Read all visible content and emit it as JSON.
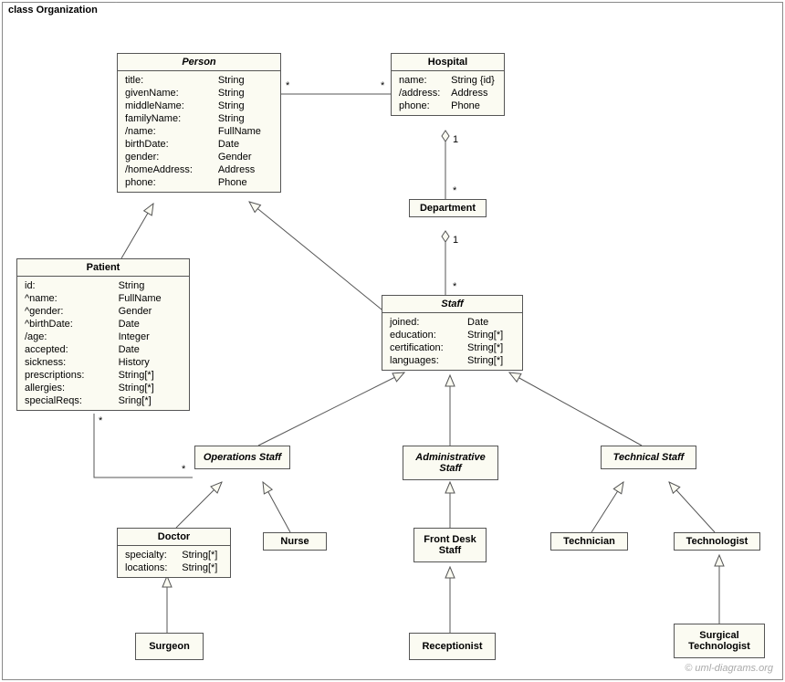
{
  "frame": {
    "title": "class Organization"
  },
  "classes": {
    "person": {
      "title": "Person",
      "attrs": [
        [
          "title:",
          "String"
        ],
        [
          "givenName:",
          "String"
        ],
        [
          "middleName:",
          "String"
        ],
        [
          "familyName:",
          "String"
        ],
        [
          "/name:",
          "FullName"
        ],
        [
          "birthDate:",
          "Date"
        ],
        [
          "gender:",
          "Gender"
        ],
        [
          "/homeAddress:",
          "Address"
        ],
        [
          "phone:",
          "Phone"
        ]
      ]
    },
    "hospital": {
      "title": "Hospital",
      "attrs": [
        [
          "name:",
          "String {id}"
        ],
        [
          "/address:",
          "Address"
        ],
        [
          "phone:",
          "Phone"
        ]
      ]
    },
    "department": {
      "title": "Department"
    },
    "patient": {
      "title": "Patient",
      "attrs": [
        [
          "id:",
          "String"
        ],
        [
          "^name:",
          "FullName"
        ],
        [
          "^gender:",
          "Gender"
        ],
        [
          "^birthDate:",
          "Date"
        ],
        [
          "/age:",
          "Integer"
        ],
        [
          "accepted:",
          "Date"
        ],
        [
          "sickness:",
          "History"
        ],
        [
          "prescriptions:",
          "String[*]"
        ],
        [
          "allergies:",
          "String[*]"
        ],
        [
          "specialReqs:",
          "Sring[*]"
        ]
      ]
    },
    "staff": {
      "title": "Staff",
      "attrs": [
        [
          "joined:",
          "Date"
        ],
        [
          "education:",
          "String[*]"
        ],
        [
          "certification:",
          "String[*]"
        ],
        [
          "languages:",
          "String[*]"
        ]
      ]
    },
    "opstaff": {
      "title": "Operations Staff"
    },
    "adminstaff": {
      "title": "Administrative Staff"
    },
    "techstaff": {
      "title": "Technical Staff"
    },
    "doctor": {
      "title": "Doctor",
      "attrs": [
        [
          "specialty:",
          "String[*]"
        ],
        [
          "locations:",
          "String[*]"
        ]
      ]
    },
    "nurse": {
      "title": "Nurse"
    },
    "frontdesk": {
      "title": "Front Desk Staff"
    },
    "receptionist": {
      "title": "Receptionist"
    },
    "technician": {
      "title": "Technician"
    },
    "technologist": {
      "title": "Technologist"
    },
    "surgeon": {
      "title": "Surgeon"
    },
    "surgtech": {
      "title": "Surgical Technologist"
    }
  },
  "mult": {
    "p_h_l": "*",
    "p_h_r": "*",
    "h_d_t": "1",
    "h_d_b": "*",
    "d_s_t": "1",
    "d_s_b": "*",
    "pat_op_l": "*",
    "pat_op_r": "*"
  },
  "watermark": "© uml-diagrams.org"
}
